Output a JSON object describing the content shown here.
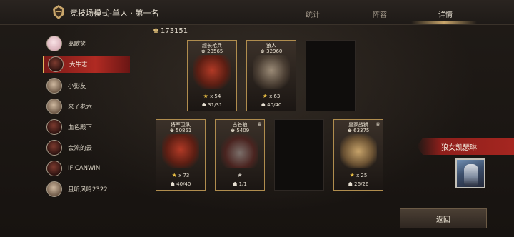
{
  "header": {
    "title": "竞技场模式-单人 · 第一名",
    "tabs": [
      {
        "label": "统计"
      },
      {
        "label": "阵容"
      },
      {
        "label": "详情"
      }
    ]
  },
  "players": [
    {
      "name": "离歌笑"
    },
    {
      "name": "大牛志"
    },
    {
      "name": "小彭友"
    },
    {
      "name": "来了老六"
    },
    {
      "name": "血色殿下"
    },
    {
      "name": "会流的云"
    },
    {
      "name": "IFICANWIN"
    },
    {
      "name": "且听风吟2322"
    }
  ],
  "lineup": {
    "total_power": "173151",
    "cards": [
      {
        "name": "超长枪兵",
        "power": "23565",
        "stars": "x 54",
        "troops": "31/31"
      },
      {
        "name": "狼人",
        "power": "32960",
        "stars": "x 63",
        "troops": "40/40"
      },
      {
        "name": "将军卫队",
        "power": "50851",
        "stars": "x 73",
        "troops": "40/40"
      },
      {
        "name": "古苍狼",
        "power": "5409",
        "stars": "",
        "troops": "1/1"
      },
      {
        "name": "皇家战狮",
        "power": "63375",
        "stars": "x 25",
        "troops": "26/26"
      }
    ]
  },
  "hero": {
    "name": "狼女凯瑟琳"
  },
  "back_label": "返回"
}
